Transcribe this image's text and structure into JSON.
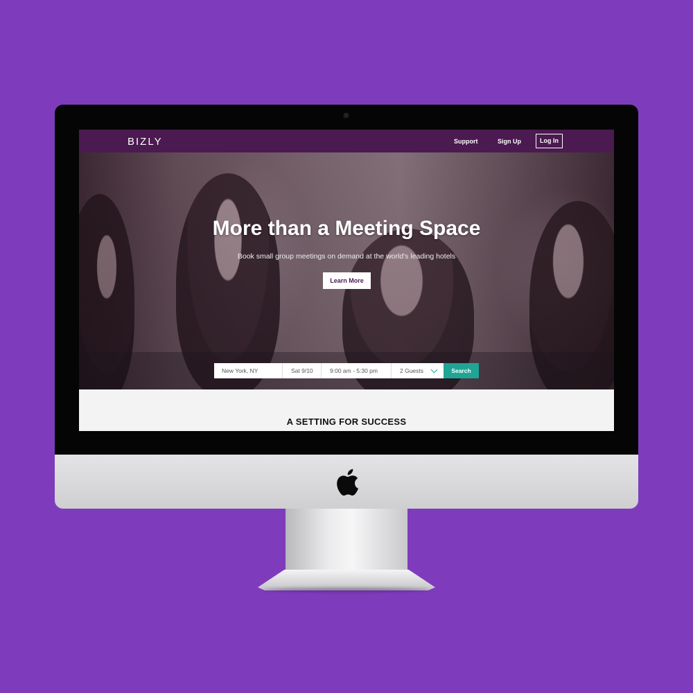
{
  "nav": {
    "brand": "BIZLY",
    "support": "Support",
    "signup": "Sign Up",
    "login": "Log In",
    "bar_color": "#4b1a50"
  },
  "hero": {
    "title": "More than a Meeting Space",
    "subtitle": "Book small group meetings on demand at the world's leading hotels",
    "cta": "Learn More"
  },
  "search": {
    "location": "New York, NY",
    "date": "Sat 9/10",
    "time": "9:00 am - 5:30 pm",
    "guests": "2 Guests",
    "button": "Search",
    "accent_color": "#1fa595"
  },
  "section": {
    "heading": "A SETTING FOR SUCCESS"
  },
  "colors": {
    "background": "#7e3cbd"
  }
}
